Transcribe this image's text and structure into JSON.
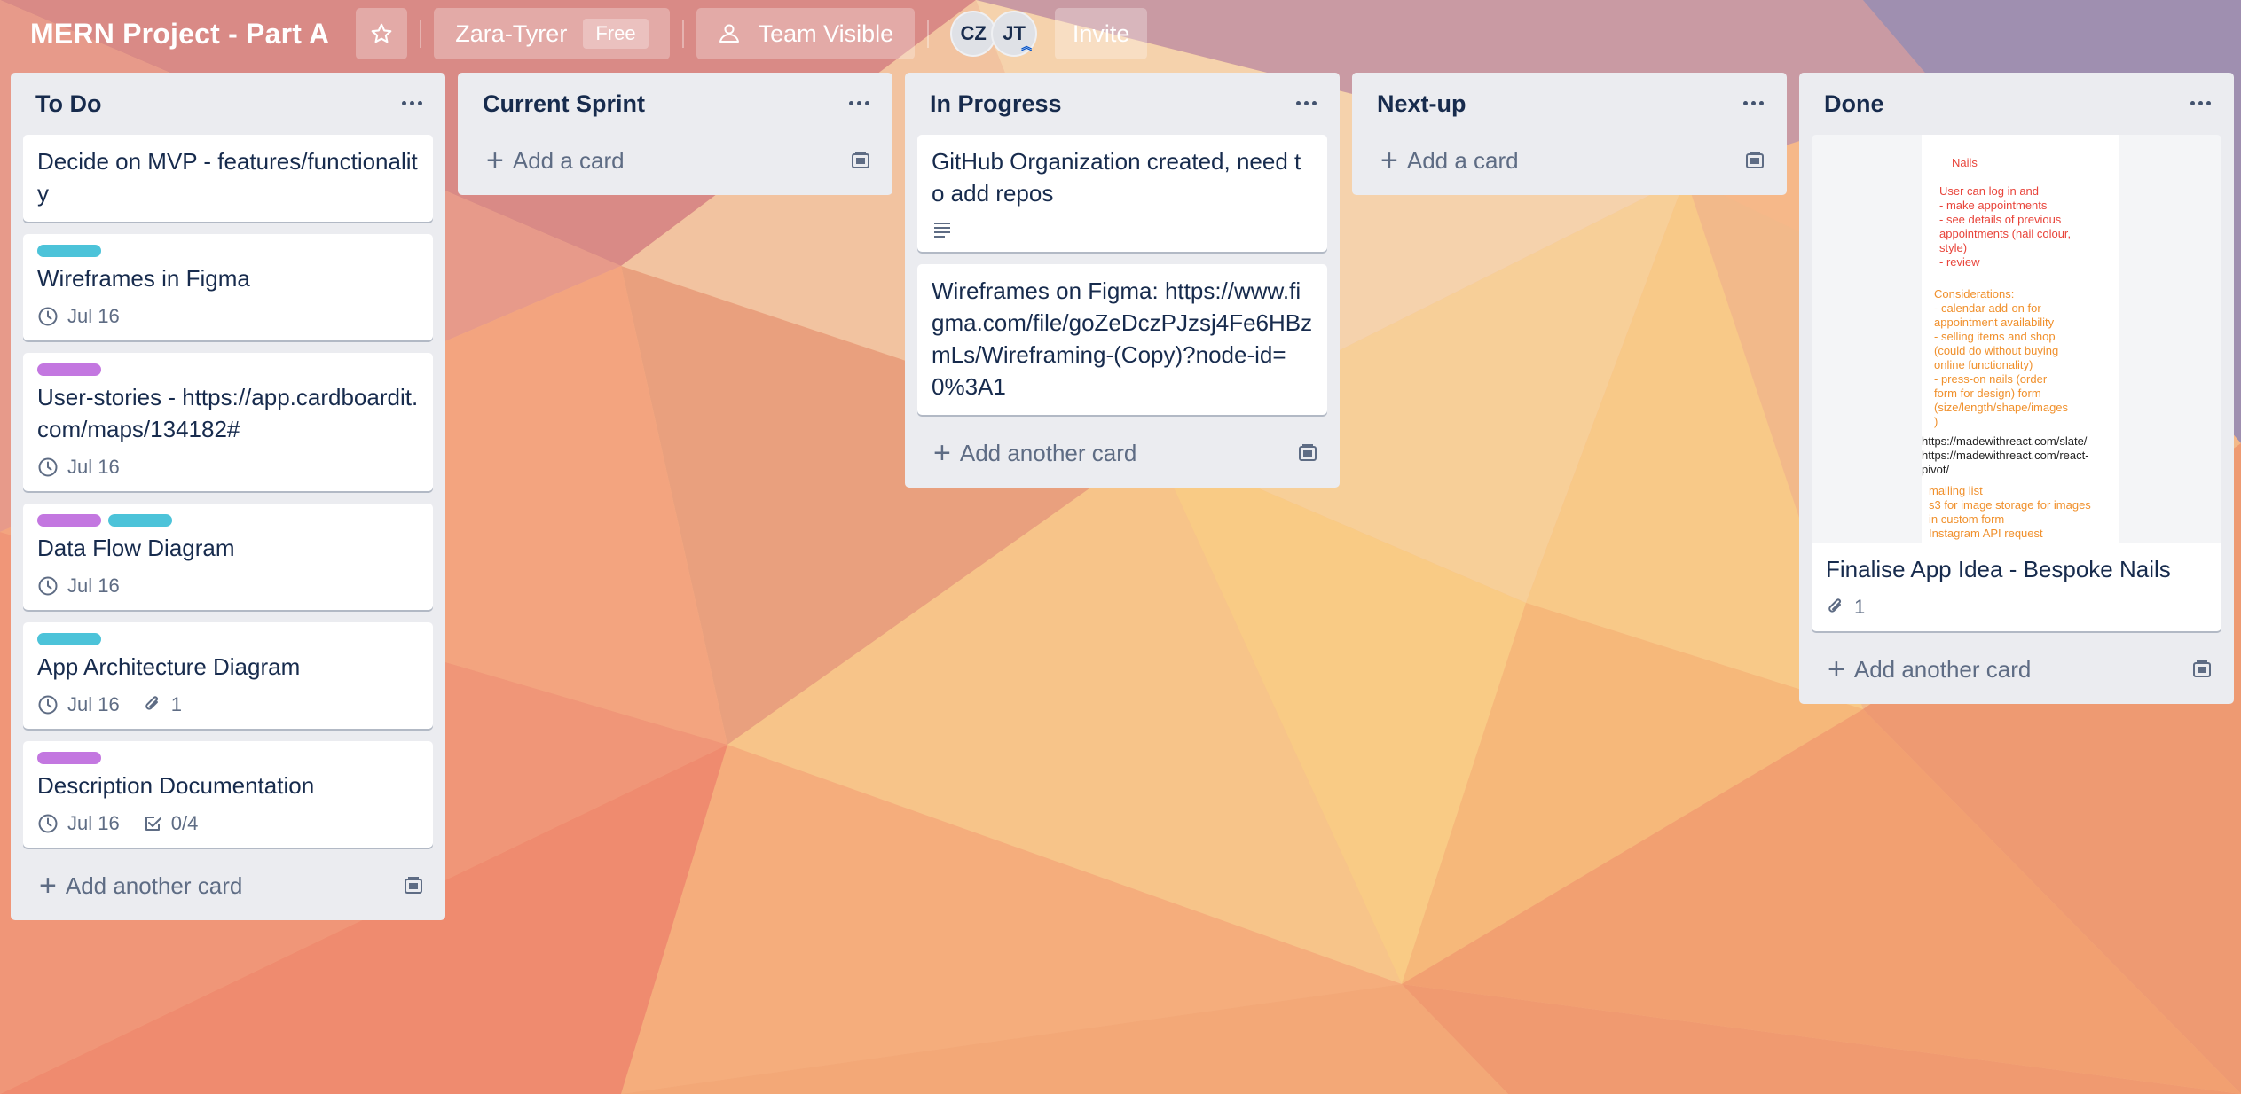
{
  "board": {
    "title": "MERN Project - Part A",
    "workspace": "Zara-Tyrer",
    "plan_badge": "Free",
    "visibility": "Team Visible",
    "members": [
      "CZ",
      "JT"
    ],
    "invite_label": "Invite"
  },
  "colors": {
    "label_cyan": "#4cc3d9",
    "label_purple": "#c377e0"
  },
  "lists": {
    "todo": {
      "title": "To Do",
      "add_label": "Add another card",
      "cards": [
        {
          "title": "Decide on MVP - features/functionality"
        },
        {
          "title": "Wireframes in Figma",
          "due": "Jul 16"
        },
        {
          "title": "User-stories - https://app.cardboardit.com/maps/134182#",
          "due": "Jul 16"
        },
        {
          "title": "Data Flow Diagram",
          "due": "Jul 16"
        },
        {
          "title": "App Architecture Diagram",
          "due": "Jul 16",
          "attachments": "1"
        },
        {
          "title": "Description Documentation",
          "due": "Jul 16",
          "checklist": "0/4"
        }
      ]
    },
    "current_sprint": {
      "title": "Current Sprint",
      "add_label": "Add a card"
    },
    "in_progress": {
      "title": "In Progress",
      "add_label": "Add another card",
      "cards": [
        {
          "title": "GitHub Organization created, need to add repos"
        },
        {
          "title": "Wireframes on Figma: https://www.figma.com/file/goZeDczPJzsj4Fe6HBzmLs/Wireframing-(Copy)?node-id=0%3A1"
        }
      ]
    },
    "next_up": {
      "title": "Next-up",
      "add_label": "Add a card"
    },
    "done": {
      "title": "Done",
      "add_label": "Add another card",
      "cards": [
        {
          "title": "Finalise App Idea - Bespoke Nails",
          "attachments": "1",
          "cover": {
            "heading": "Nails",
            "features": "User can log in and\n- make appointments\n- see details of previous\nappointments (nail colour,\nstyle)\n- review",
            "considerations": "Considerations:\n- calendar add-on for\nappointment availability\n- selling items and shop\n(could do without buying\nonline functionality)\n- press-on nails (order\nform for design) form\n(size/length/shape/images\n)",
            "links": "https://madewithreact.com/slate/\nhttps://madewithreact.com/react-\npivot/",
            "extras": "mailing list\ns3 for image storage for images\nin custom form\nInstagram API request"
          }
        }
      ]
    }
  }
}
